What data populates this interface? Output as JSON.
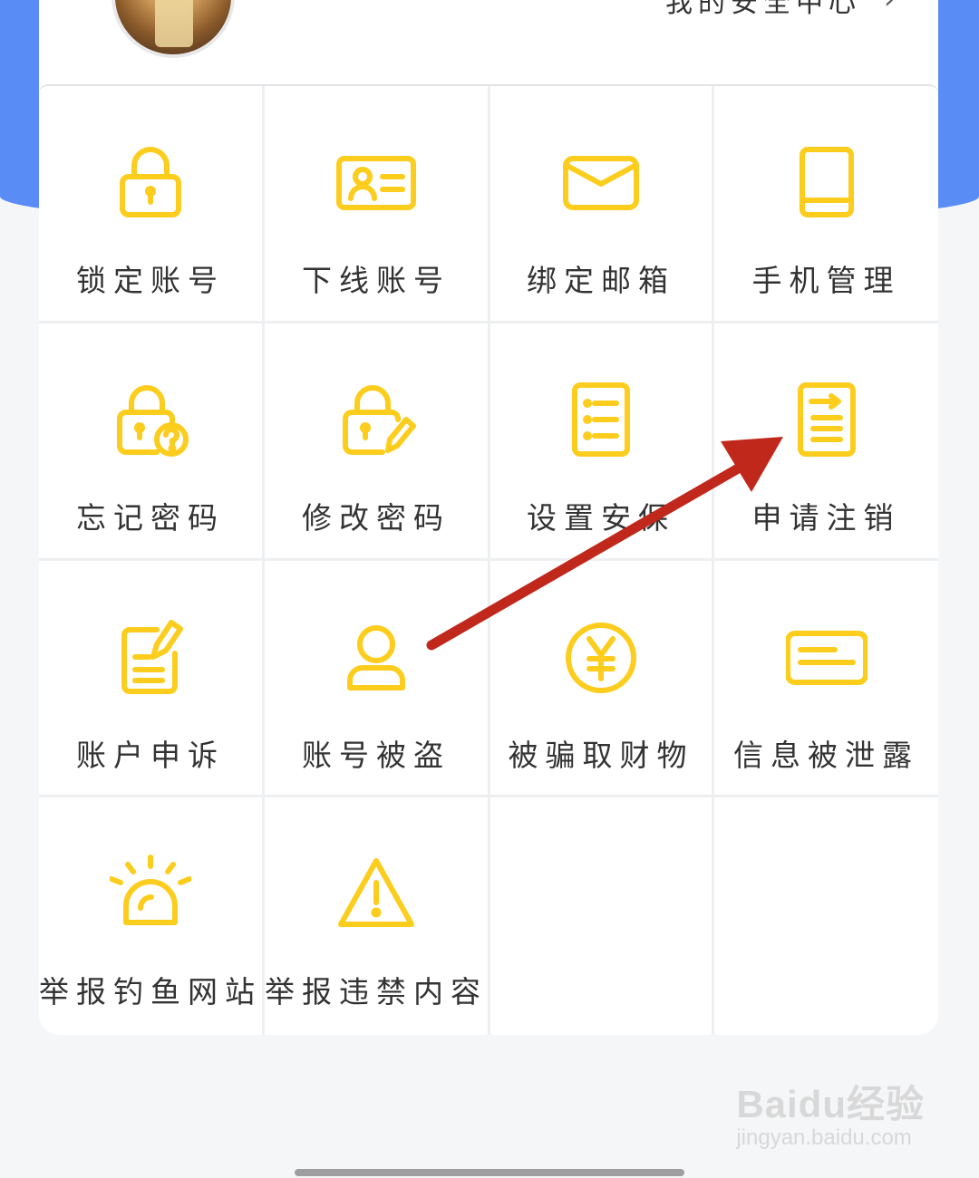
{
  "header": {
    "top_link_label": "我的安全中心",
    "chevron": "›"
  },
  "grid": {
    "items": [
      {
        "label": "锁定账号",
        "icon": "lock-icon"
      },
      {
        "label": "下线账号",
        "icon": "id-card-icon"
      },
      {
        "label": "绑定邮箱",
        "icon": "envelope-icon"
      },
      {
        "label": "手机管理",
        "icon": "phone-icon"
      },
      {
        "label": "忘记密码",
        "icon": "lock-question-icon"
      },
      {
        "label": "修改密码",
        "icon": "lock-edit-icon"
      },
      {
        "label": "设置安保",
        "icon": "list-icon"
      },
      {
        "label": "申请注销",
        "icon": "document-arrow-icon"
      },
      {
        "label": "账户申诉",
        "icon": "edit-note-icon"
      },
      {
        "label": "账号被盗",
        "icon": "user-icon"
      },
      {
        "label": "被骗取财物",
        "icon": "yen-icon"
      },
      {
        "label": "信息被泄露",
        "icon": "message-icon"
      },
      {
        "label": "举报钓鱼网站",
        "icon": "alarm-icon"
      },
      {
        "label": "举报违禁内容",
        "icon": "warning-icon"
      }
    ]
  },
  "colors": {
    "accent_yellow": "#fccd1d",
    "header_blue": "#5a8cf5",
    "annotation_red": "#c0281c"
  },
  "watermark": {
    "brand": "Baidu经验",
    "url": "jingyan.baidu.com"
  }
}
